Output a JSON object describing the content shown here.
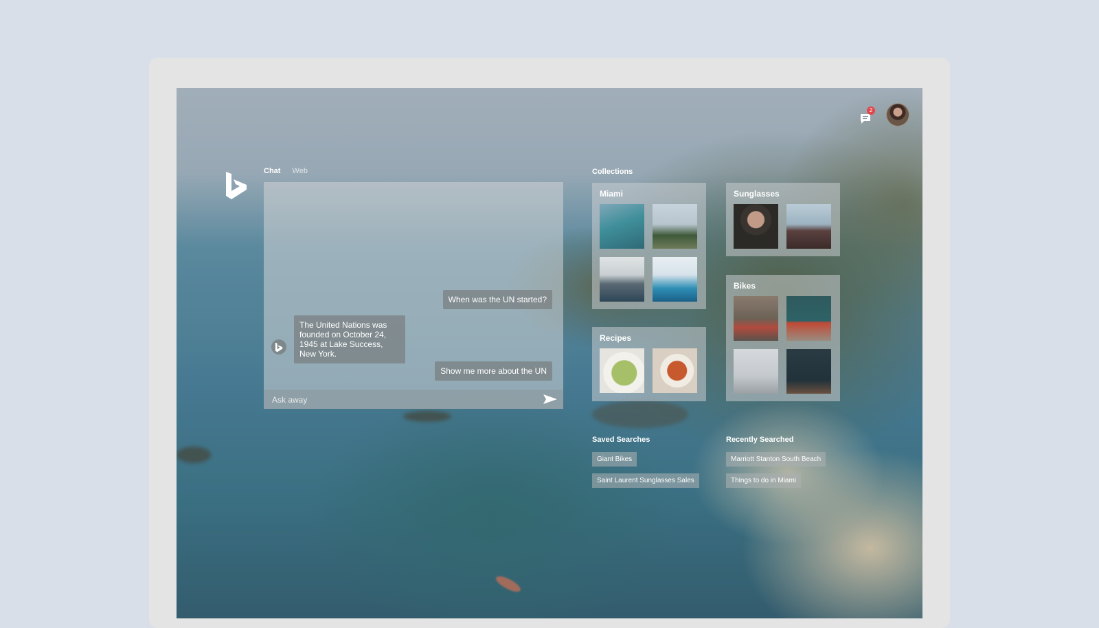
{
  "chat_tabs": [
    {
      "label": "Chat",
      "active": true
    },
    {
      "label": "Web",
      "active": false
    }
  ],
  "notifications": {
    "count": "2",
    "icon": "chat-bubble-icon"
  },
  "chat": {
    "messages": [
      {
        "role": "user",
        "text": "When was the UN started?"
      },
      {
        "role": "assistant",
        "text": "The United Nations was founded on October 24, 1945 at Lake Success, New York."
      },
      {
        "role": "user",
        "text": "Show me more about the UN"
      }
    ],
    "input_placeholder": "Ask away",
    "send_icon": "send-icon"
  },
  "collections": {
    "heading": "Collections",
    "items": [
      {
        "title": "Miami",
        "thumbs": [
          "aerial-causeway",
          "palm-trees",
          "city-skyline",
          "modern-building"
        ]
      },
      {
        "title": "Sunglasses",
        "thumbs": [
          "woman-sunglasses",
          "round-sunglasses"
        ]
      },
      {
        "title": "Recipes",
        "thumbs": [
          "green-soup",
          "curry-bowl"
        ]
      },
      {
        "title": "Bikes",
        "thumbs": [
          "red-bike-wall",
          "red-bike-teal",
          "white-bike",
          "black-bike"
        ]
      }
    ]
  },
  "saved_searches": {
    "heading": "Saved Searches",
    "items": [
      "Giant Bikes",
      "Saint Laurent Sunglasses Sales"
    ]
  },
  "recently_searched": {
    "heading": "Recently Searched",
    "items": [
      "Marriott Stanton South Beach",
      "Things to do in Miami"
    ]
  },
  "colors": {
    "page_background": "#d8dfe8",
    "device_frame": "#e4e4e4",
    "badge": "#e0474c"
  }
}
